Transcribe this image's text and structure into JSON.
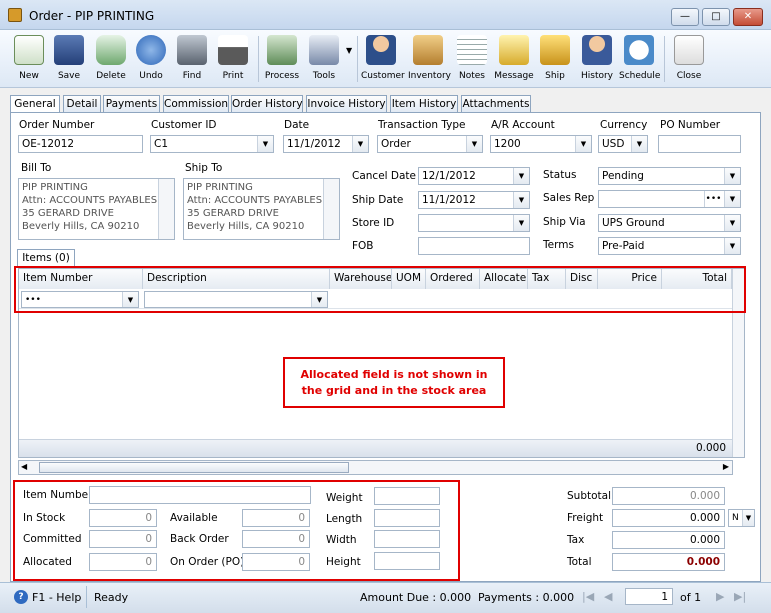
{
  "window": {
    "title": "Order - PIP PRINTING"
  },
  "toolbar": {
    "new": "New",
    "save": "Save",
    "delete": "Delete",
    "undo": "Undo",
    "find": "Find",
    "print": "Print",
    "process": "Process",
    "tools": "Tools",
    "customer": "Customer",
    "inventory": "Inventory",
    "notes": "Notes",
    "message": "Message",
    "ship": "Ship",
    "history": "History",
    "schedule": "Schedule",
    "close": "Close"
  },
  "tabs": [
    "General",
    "Detail",
    "Payments",
    "Commission",
    "Order History",
    "Invoice History",
    "Item History",
    "Attachments"
  ],
  "header": {
    "order_number_label": "Order Number",
    "order_number": "OE-12012",
    "customer_id_label": "Customer ID",
    "customer_id": "C1",
    "date_label": "Date",
    "date": "11/1/2012",
    "transaction_type_label": "Transaction Type",
    "transaction_type": "Order",
    "ar_account_label": "A/R Account",
    "ar_account": "1200",
    "currency_label": "Currency",
    "currency": "USD",
    "po_number_label": "PO Number",
    "po_number": ""
  },
  "bill_to": {
    "label": "Bill To",
    "lines": [
      "PIP PRINTING",
      "Attn: ACCOUNTS PAYABLES",
      "35 GERARD DRIVE",
      "Beverly Hills, CA 90210"
    ]
  },
  "ship_to": {
    "label": "Ship To",
    "lines": [
      "PIP PRINTING",
      "Attn: ACCOUNTS PAYABLES",
      "35 GERARD DRIVE",
      "Beverly Hills, CA 90210"
    ]
  },
  "dates": {
    "cancel_date_label": "Cancel  Date",
    "cancel_date": "12/1/2012",
    "ship_date_label": "Ship Date",
    "ship_date": "11/1/2012",
    "store_id_label": "Store ID",
    "store_id": "",
    "fob_label": "FOB",
    "fob": ""
  },
  "status": {
    "status_label": "Status",
    "status": "Pending",
    "sales_rep_label": "Sales Rep",
    "sales_rep": "",
    "ship_via_label": "Ship Via",
    "ship_via": "UPS Ground",
    "terms_label": "Terms",
    "terms": "Pre-Paid"
  },
  "items": {
    "tab_label": "Items (0)",
    "columns": [
      "Item Number",
      "Description",
      "Warehouse",
      "UOM",
      "Ordered",
      "Allocate",
      "Tax",
      "Disc",
      "Price",
      "Total"
    ],
    "edit_row_value": "•••",
    "footer_total": "0.000"
  },
  "callout": {
    "line1": "Allocated field is not shown in",
    "line2": "the grid and in the stock area"
  },
  "stock": {
    "item_number_label": "Item Number",
    "item_number": "",
    "in_stock_label": "In Stock",
    "in_stock": "0",
    "committed_label": "Committed",
    "committed": "0",
    "allocated_label": "Allocated",
    "allocated": "0",
    "available_label": "Available",
    "available": "0",
    "back_order_label": "Back Order",
    "back_order": "0",
    "on_order_label": "On Order (PO)",
    "on_order": "0",
    "weight_label": "Weight",
    "length_label": "Length",
    "width_label": "Width",
    "height_label": "Height"
  },
  "totals": {
    "subtotal_label": "Subtotal",
    "subtotal": "0.000",
    "freight_label": "Freight",
    "freight": "0.000",
    "freight_code": "N",
    "tax_label": "Tax",
    "tax": "0.000",
    "total_label": "Total",
    "total": "0.000"
  },
  "statusbar": {
    "help": "F1 - Help",
    "ready": "Ready",
    "amount_due": "Amount Due : 0.000",
    "payments": "Payments : 0.000",
    "page": "1",
    "of": "of  1"
  },
  "colors": {
    "accent_red": "#e00000",
    "total_value": "#8b0000"
  }
}
